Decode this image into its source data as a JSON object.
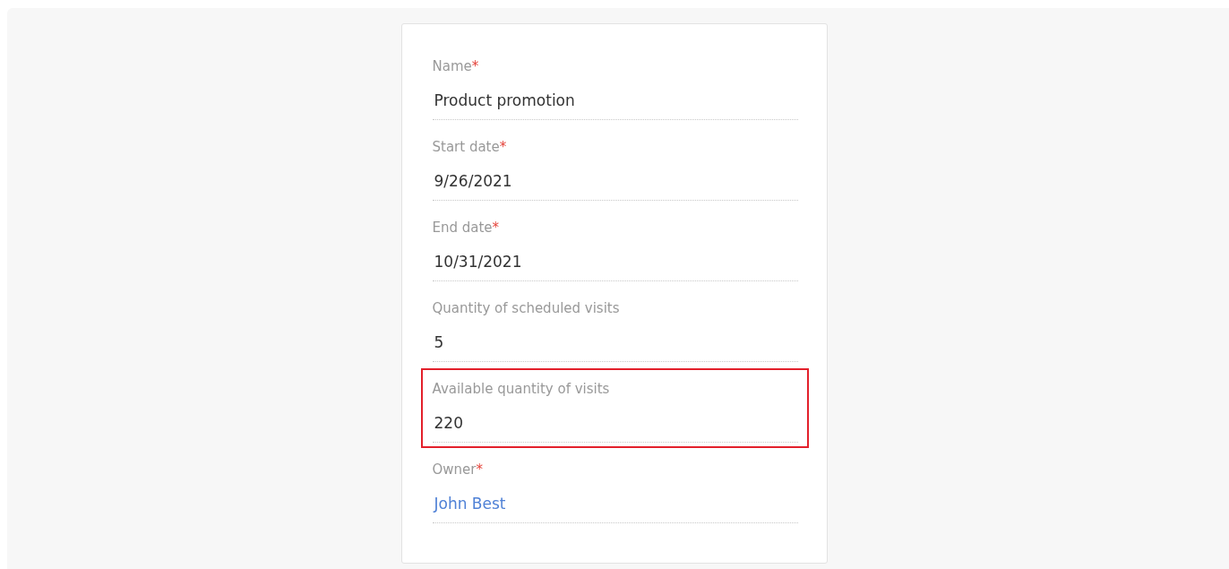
{
  "fields": [
    {
      "label": "Name",
      "required_mark": "*",
      "value": "Product promotion",
      "kind": "text",
      "highlighted": false
    },
    {
      "label": "Start date",
      "required_mark": "*",
      "value": "9/26/2021",
      "kind": "text",
      "highlighted": false
    },
    {
      "label": "End date",
      "required_mark": "*",
      "value": "10/31/2021",
      "kind": "text",
      "highlighted": false
    },
    {
      "label": "Quantity of scheduled visits",
      "value": "5",
      "kind": "text",
      "highlighted": false
    },
    {
      "label": "Available quantity of visits",
      "value": "220",
      "kind": "text",
      "highlighted": true
    },
    {
      "label": "Owner",
      "required_mark": "*",
      "value": "John Best",
      "kind": "link",
      "highlighted": false
    }
  ]
}
